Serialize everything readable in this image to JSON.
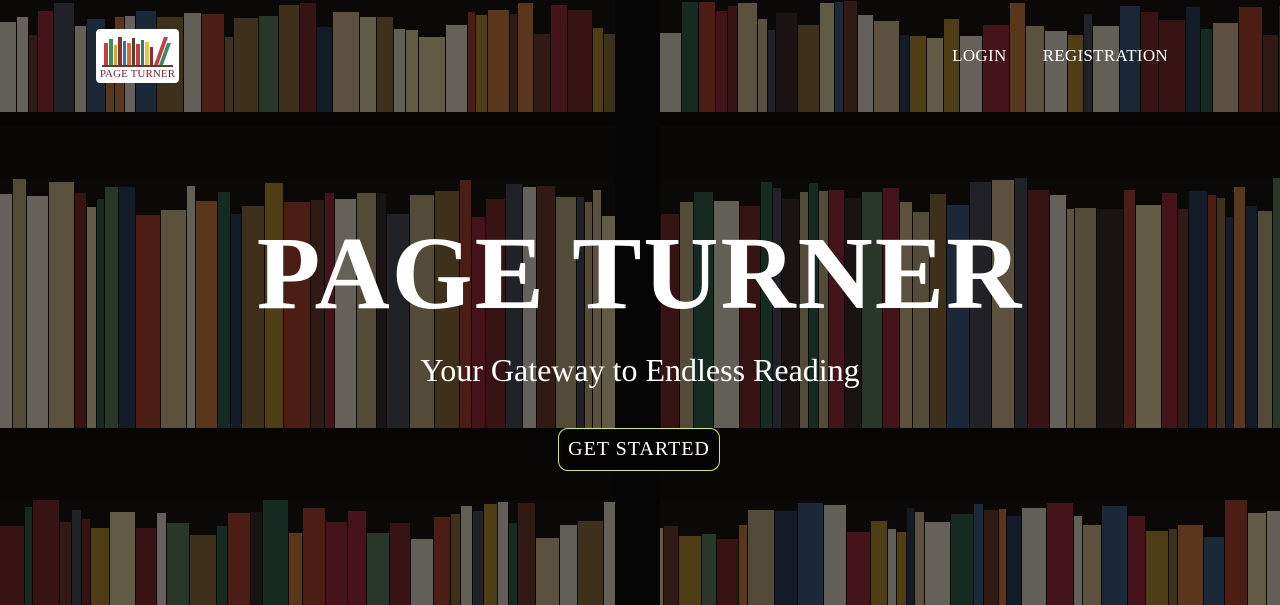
{
  "brand": {
    "logo_text": "PAGE TURNER",
    "logo_icon": "books-icon"
  },
  "nav": {
    "login_label": "LOGIN",
    "registration_label": "REGISTRATION"
  },
  "hero": {
    "title": "PAGE TURNER",
    "subtitle": "Your Gateway to Endless Reading",
    "cta_label": "GET STARTED"
  },
  "colors": {
    "cta_border": "#d4ec5a",
    "text": "#ffffff",
    "logo_text": "#7a2330"
  }
}
